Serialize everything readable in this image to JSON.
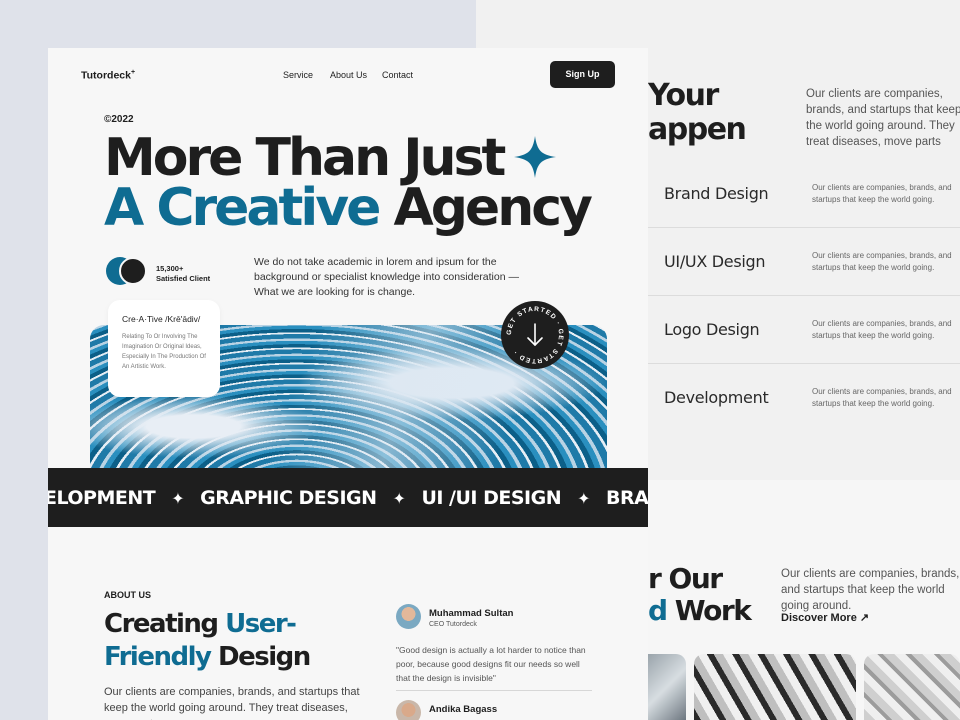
{
  "colors": {
    "accent": "#0f6c92",
    "dark": "#1e1e1e",
    "card_bg": "#f7f7f7"
  },
  "header": {
    "logo": "Tutordeck",
    "logo_mark": "+",
    "nav": [
      "Service",
      "About Us",
      "Contact"
    ],
    "signup_label": "Sign Up"
  },
  "hero": {
    "year": "©2022",
    "line1": "More Than Just",
    "line2_accent": "A Creative",
    "line2_rest": "Agency",
    "client_count": "15,300+",
    "client_label": "Satisfied Client",
    "description": "We do not take academic in lorem and ipsum for the background or specialist knowledge into consideration — What we are looking for is change.",
    "definition_title": "Cre·A·Tive /Krē'ādiv/",
    "definition_body": "Relating To Or Involving The Imagination Or Original Ideas, Especially In The Production Of An Artistic Work.",
    "badge_text": "GET STARTED · GET STARTED ·"
  },
  "ticker": [
    "ELOPMENT",
    "GRAPHIC DESIGN",
    "UI /UI DESIGN",
    "BRAND DESIGN"
  ],
  "about": {
    "label": "ABOUT US",
    "heading_part1": "Creating",
    "heading_accent1": "User-",
    "heading_accent2": "Friendly",
    "heading_part2": "Design",
    "text": "Our clients are companies, brands, and startups that keep the world going around. They treat diseases, move parts..."
  },
  "testimonials": [
    {
      "name": "Muhammad Sultan",
      "role": "CEO Tutordeck",
      "quote": "\"Good design is actually a lot harder to notice than poor, because good designs fit our needs so well that the design is invisible\""
    },
    {
      "name": "Andika Bagass"
    }
  ],
  "background_page": {
    "heading_top_1": "Your",
    "heading_top_2": "appen",
    "para_top": "Our clients are companies, brands, and startups that keep the world going around. They treat diseases, move parts",
    "services": [
      {
        "title": "Brand Design",
        "desc": "Our clients are companies, brands, and startups that keep the world going."
      },
      {
        "title": "UI/UX Design",
        "desc": "Our clients are companies, brands, and startups that keep the world going."
      },
      {
        "title": "Logo Design",
        "desc": "Our clients are companies, brands, and startups that keep the world going."
      },
      {
        "title": "Development",
        "desc": "Our clients are companies, brands, and startups that keep the world going."
      }
    ],
    "heading_bottom_1": "r Our",
    "heading_bottom_2_accent": "d",
    "heading_bottom_2_rest": "Work",
    "para_bottom": "Our clients are companies, brands, and startups that keep the world going around.",
    "discover_label": "Discover More ↗"
  }
}
